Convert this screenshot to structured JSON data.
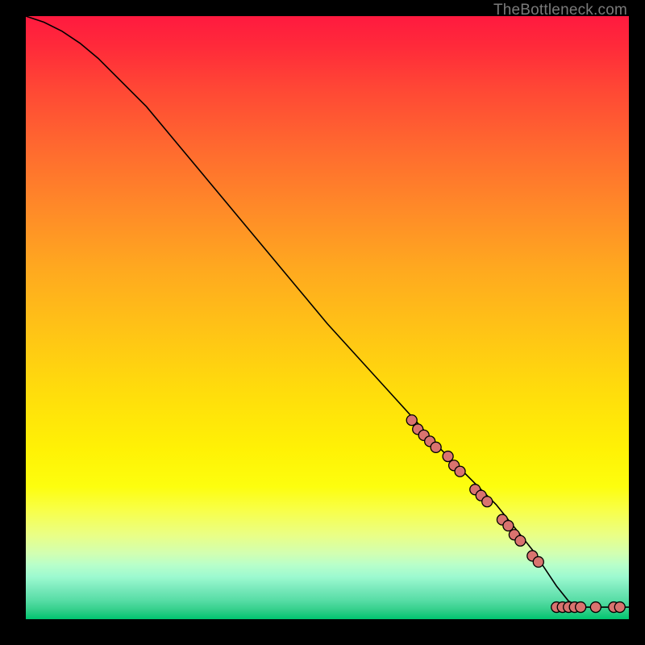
{
  "watermark": "TheBottleneck.com",
  "colors": {
    "line": "#000000",
    "marker_fill": "#d9736f",
    "marker_stroke": "#000000",
    "frame_bg": "#000000"
  },
  "chart_data": {
    "type": "line",
    "title": "",
    "xlabel": "",
    "ylabel": "",
    "xlim": [
      0,
      100
    ],
    "ylim": [
      0,
      100
    ],
    "grid": false,
    "legend": false,
    "series": [
      {
        "name": "curve",
        "x": [
          0,
          3,
          6,
          9,
          12,
          15,
          20,
          25,
          30,
          35,
          40,
          45,
          50,
          55,
          60,
          65,
          68,
          70,
          72,
          74,
          76,
          78,
          80,
          82,
          84,
          86,
          88,
          90,
          92,
          94,
          96,
          98,
          100
        ],
        "y": [
          100,
          99,
          97.5,
          95.5,
          93,
          90,
          85,
          79,
          73,
          67,
          61,
          55,
          49,
          43.5,
          38,
          32.5,
          29,
          27,
          25,
          23,
          21,
          19,
          16.5,
          14,
          11.5,
          8.5,
          5.5,
          3,
          2,
          2,
          2,
          2,
          2
        ]
      }
    ],
    "markers": [
      {
        "x": 64,
        "y": 33
      },
      {
        "x": 65,
        "y": 31.5
      },
      {
        "x": 66,
        "y": 30.5
      },
      {
        "x": 67,
        "y": 29.5
      },
      {
        "x": 68,
        "y": 28.5
      },
      {
        "x": 70,
        "y": 27
      },
      {
        "x": 71,
        "y": 25.5
      },
      {
        "x": 72,
        "y": 24.5
      },
      {
        "x": 74.5,
        "y": 21.5
      },
      {
        "x": 75.5,
        "y": 20.5
      },
      {
        "x": 76.5,
        "y": 19.5
      },
      {
        "x": 79,
        "y": 16.5
      },
      {
        "x": 80,
        "y": 15.5
      },
      {
        "x": 81,
        "y": 14
      },
      {
        "x": 82,
        "y": 13
      },
      {
        "x": 84,
        "y": 10.5
      },
      {
        "x": 85,
        "y": 9.5
      },
      {
        "x": 88,
        "y": 2
      },
      {
        "x": 89,
        "y": 2
      },
      {
        "x": 90,
        "y": 2
      },
      {
        "x": 91,
        "y": 2
      },
      {
        "x": 92,
        "y": 2
      },
      {
        "x": 94.5,
        "y": 2
      },
      {
        "x": 97.5,
        "y": 2
      },
      {
        "x": 98.5,
        "y": 2
      }
    ]
  }
}
